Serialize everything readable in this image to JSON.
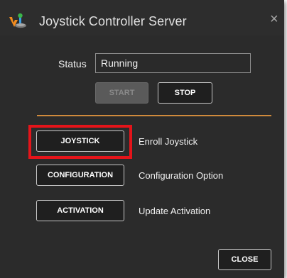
{
  "window": {
    "title": "Joystick Controller Server",
    "close_glyph": "×",
    "app_icon": "joystick-app-icon"
  },
  "status": {
    "label": "Status",
    "value": "Running"
  },
  "controls": {
    "start_label": "START",
    "stop_label": "STOP"
  },
  "menu": [
    {
      "button_label": "JOYSTICK",
      "description": "Enroll Joystick",
      "highlighted": true
    },
    {
      "button_label": "CONFIGURATION",
      "description": "Configuration Option",
      "highlighted": false
    },
    {
      "button_label": "ACTIVATION",
      "description": "Update Activation",
      "highlighted": false
    }
  ],
  "footer": {
    "close_label": "CLOSE"
  },
  "colors": {
    "window_bg": "#2b2b2b",
    "accent_divider": "#d08a3c",
    "highlight_border": "#e4141a"
  }
}
